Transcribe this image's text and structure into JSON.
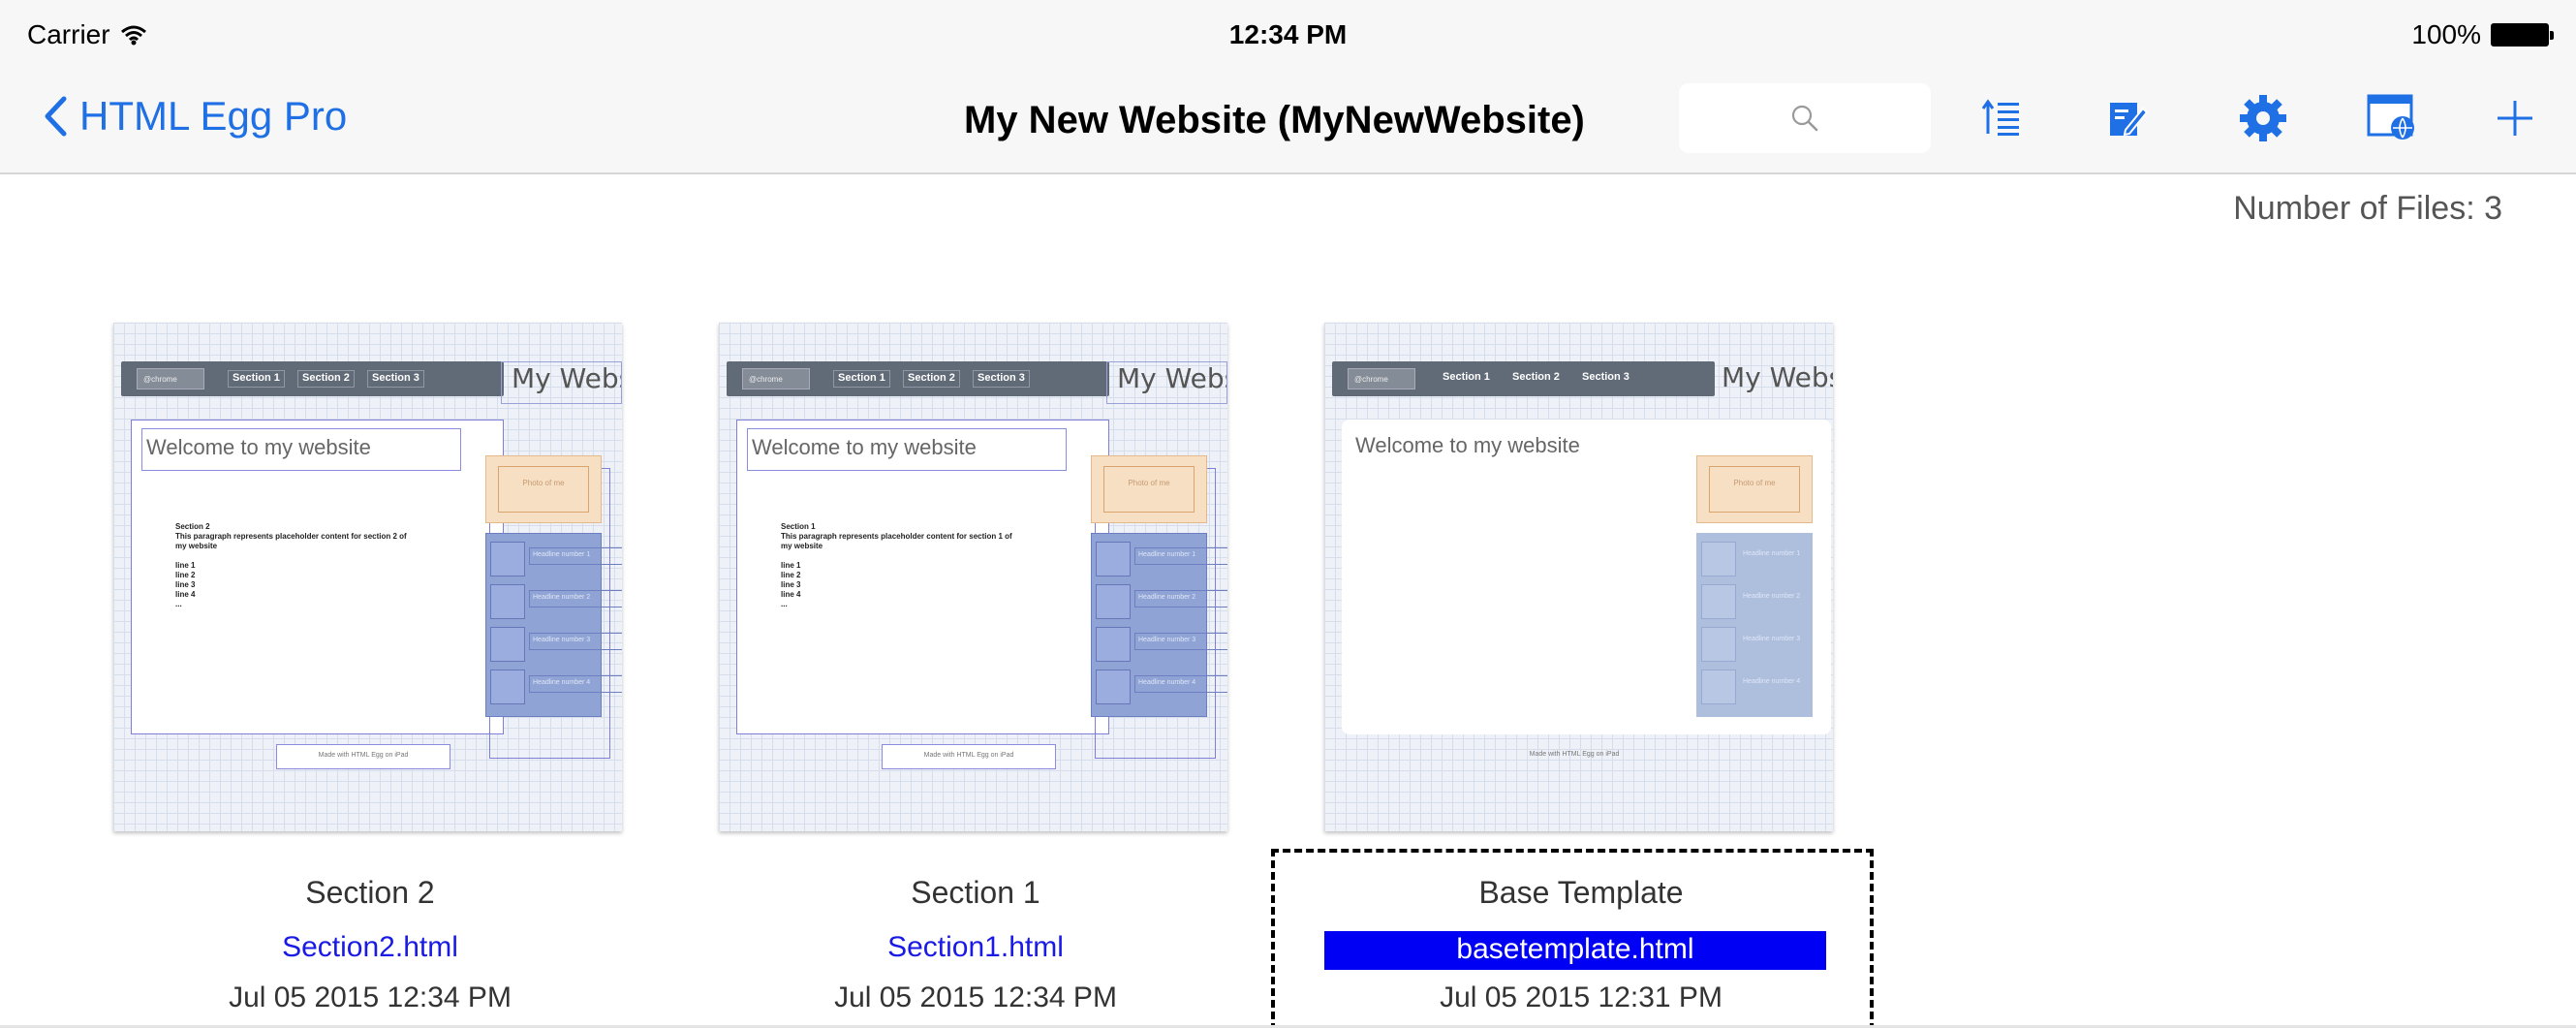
{
  "status_bar": {
    "carrier": "Carrier",
    "time": "12:34 PM",
    "battery": "100%"
  },
  "nav": {
    "back_label": "HTML Egg Pro",
    "title": "My New Website (MyNewWebsite)",
    "search_icon": "search-icon",
    "icons": [
      "sort-icon",
      "edit-icon",
      "gear-icon",
      "browser-preview-icon",
      "add-icon"
    ],
    "accent_color": "#1f6fe5"
  },
  "file_count": "Number of Files: 3",
  "files": [
    {
      "title": "Section 2",
      "filename": "Section2.html",
      "date": "Jul 05 2015 12:34 PM",
      "selected": false,
      "thumb": {
        "logo": "@chrome",
        "sections": [
          "Section 1",
          "Section 2",
          "Section 3"
        ],
        "site_title": "My Website",
        "welcome": "Welcome to my website",
        "body_lines": [
          "Section 2",
          "This paragraph represents placeholder content for section 2 of",
          "my website",
          "",
          "line 1",
          "line 2",
          "line 3",
          "line 4",
          "..."
        ],
        "photo": "Photo of me",
        "headlines": [
          "Headline number 1",
          "Headline number 2",
          "Headline number 3",
          "Headline number 4"
        ],
        "footer": "Made with HTML Egg on iPad"
      }
    },
    {
      "title": "Section 1",
      "filename": "Section1.html",
      "date": "Jul 05 2015 12:34 PM",
      "selected": false,
      "thumb": {
        "logo": "@chrome",
        "sections": [
          "Section 1",
          "Section 2",
          "Section 3"
        ],
        "site_title": "My Website",
        "welcome": "Welcome to my website",
        "body_lines": [
          "Section 1",
          "This paragraph represents placeholder content for section 1 of",
          "my website",
          "",
          "line 1",
          "line 2",
          "line 3",
          "line 4",
          "..."
        ],
        "photo": "Photo of me",
        "headlines": [
          "Headline number 1",
          "Headline number 2",
          "Headline number 3",
          "Headline number 4"
        ],
        "footer": "Made with HTML Egg on iPad"
      }
    },
    {
      "title": "Base Template",
      "filename": "basetemplate.html",
      "date": "Jul 05 2015 12:31 PM",
      "selected": true,
      "thumb": {
        "logo": "@chrome",
        "sections": [
          "Section 1",
          "Section 2",
          "Section 3"
        ],
        "site_title": "My Website",
        "welcome": "Welcome to my website",
        "body_lines": [],
        "photo": "Photo of me",
        "headlines": [
          "Headline number 1",
          "Headline number 2",
          "Headline number 3",
          "Headline number 4"
        ],
        "footer": "Made with HTML Egg on iPad"
      }
    }
  ],
  "colors": {
    "link_blue": "#1a1ae6",
    "selection_blue": "#0000f5"
  }
}
